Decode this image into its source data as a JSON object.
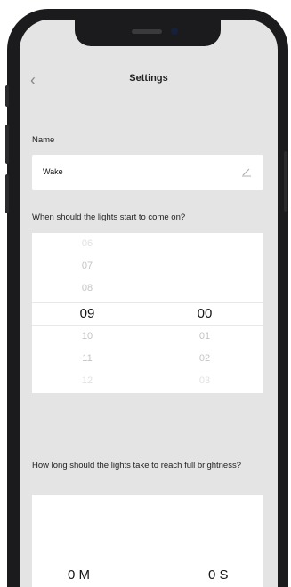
{
  "nav": {
    "title": "Settings",
    "back_icon": "chevron-left-icon"
  },
  "name": {
    "label": "Name",
    "value": "Wake",
    "edit_icon": "pencil-icon"
  },
  "start_time": {
    "label": "When should the lights start to come on?",
    "hours": [
      "06",
      "07",
      "08",
      "09",
      "10",
      "11",
      "12"
    ],
    "selected_hour": "09",
    "minutes": [
      "",
      "",
      "",
      "00",
      "01",
      "02",
      "03"
    ],
    "selected_minute": "00"
  },
  "duration": {
    "label": "How long should the lights take to reach full brightness?",
    "minutes_value": "0 M",
    "seconds_value": "0 S"
  }
}
